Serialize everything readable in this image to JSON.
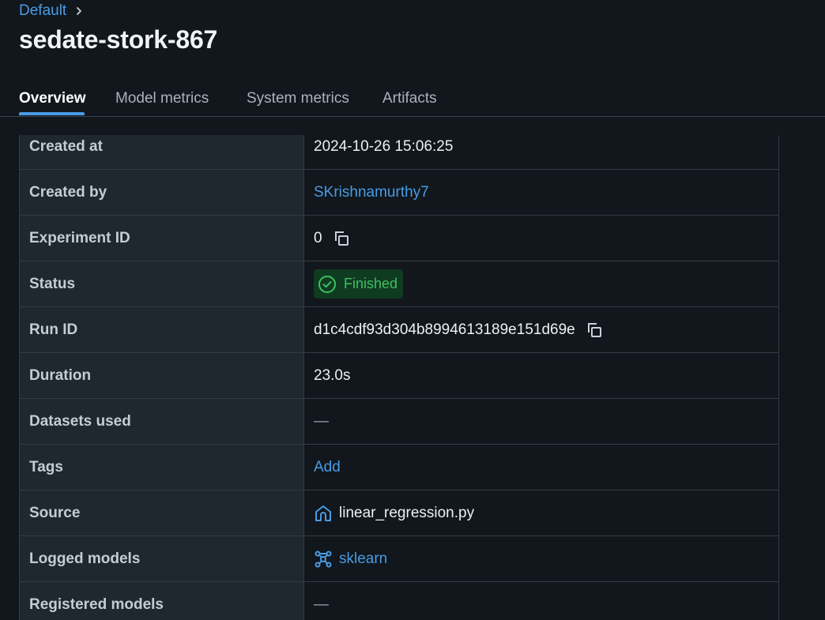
{
  "breadcrumb": {
    "parent": "Default"
  },
  "run": {
    "title": "sedate-stork-867"
  },
  "tabs": [
    {
      "label": "Overview"
    },
    {
      "label": "Model metrics"
    },
    {
      "label": "System metrics"
    },
    {
      "label": "Artifacts"
    }
  ],
  "details": {
    "created_at": {
      "label": "Created at",
      "value": "2024-10-26 15:06:25"
    },
    "created_by": {
      "label": "Created by",
      "value": "SKrishnamurthy7"
    },
    "experiment_id": {
      "label": "Experiment ID",
      "value": "0"
    },
    "status": {
      "label": "Status",
      "value": "Finished"
    },
    "run_id": {
      "label": "Run ID",
      "value": "d1c4cdf93d304b8994613189e151d69e"
    },
    "duration": {
      "label": "Duration",
      "value": "23.0s"
    },
    "datasets": {
      "label": "Datasets used",
      "value": "—"
    },
    "tags": {
      "label": "Tags",
      "value": "Add"
    },
    "source": {
      "label": "Source",
      "value": "linear_regression.py"
    },
    "logged_models": {
      "label": "Logged models",
      "value": "sklearn"
    },
    "registered_models": {
      "label": "Registered models",
      "value": "—"
    }
  },
  "colors": {
    "accent": "#4a9be4",
    "success": "#3fbf63",
    "success_bg": "#0f3b20"
  },
  "icons": [
    "chevron-right-icon",
    "copy-icon",
    "check-circle-icon",
    "source-icon",
    "model-icon"
  ]
}
